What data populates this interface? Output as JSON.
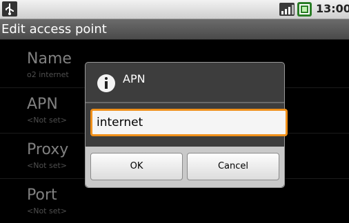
{
  "status_bar": {
    "time": "13:00",
    "icons": [
      "usb-icon",
      "signal-icon",
      "battery-icon"
    ]
  },
  "title_bar": {
    "title": "Edit access point"
  },
  "preferences": [
    {
      "title": "Name",
      "summary": "o2 internet"
    },
    {
      "title": "APN",
      "summary": "<Not set>"
    },
    {
      "title": "Proxy",
      "summary": "<Not set>"
    },
    {
      "title": "Port",
      "summary": "<Not set>"
    }
  ],
  "dialog": {
    "title": "APN",
    "input_value": "internet",
    "ok_label": "OK",
    "cancel_label": "Cancel"
  },
  "colors": {
    "accent": "#f0901a",
    "background": "#000000",
    "dialog_bg": "#3d3d3d"
  }
}
